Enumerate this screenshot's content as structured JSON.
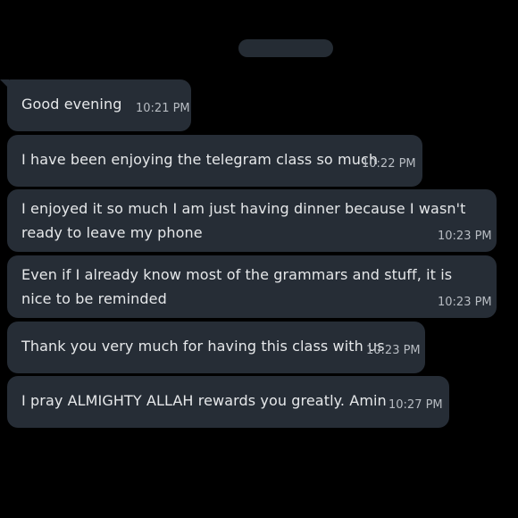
{
  "messages": [
    {
      "text": "Good evening",
      "time": "10:21 PM"
    },
    {
      "text": "I have been enjoying the telegram class so much",
      "time": "10:22 PM"
    },
    {
      "text": "I enjoyed it so much I am just having dinner because I wasn't ready to leave my phone",
      "time": "10:23 PM"
    },
    {
      "text": "Even if I already know most of the grammars and stuff, it is nice to be reminded",
      "time": "10:23 PM"
    },
    {
      "text": "Thank you very much for having this class with us",
      "time": "10:23 PM"
    },
    {
      "text": "I pray ALMIGHTY ALLAH rewards you greatly. Amin",
      "time": "10:27 PM"
    }
  ],
  "colors": {
    "background": "#000000",
    "bubble": "#262d36",
    "text": "#e6e8ea",
    "time": "#b7bcc2"
  }
}
